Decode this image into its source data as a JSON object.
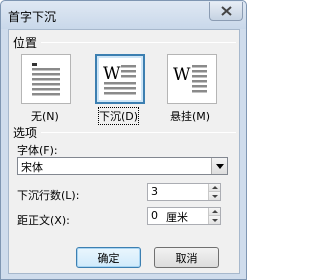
{
  "window": {
    "title": "首字下沉"
  },
  "position": {
    "group_label": "位置",
    "options": [
      {
        "label": "无(N)",
        "icon": "no-dropcap-icon",
        "selected": false
      },
      {
        "label": "下沉(D)",
        "icon": "dropped-icon",
        "selected": true
      },
      {
        "label": "悬挂(M)",
        "icon": "in-margin-icon",
        "selected": false
      }
    ]
  },
  "options": {
    "group_label": "选项",
    "font_label": "字体(F):",
    "font_value": "宋体",
    "lines_label": "下沉行数(L):",
    "lines_value": "3",
    "distance_label": "距正文(X):",
    "distance_value": "0",
    "distance_unit": "厘米"
  },
  "buttons": {
    "ok": "确定",
    "cancel": "取消"
  },
  "icon_glyph": "W"
}
